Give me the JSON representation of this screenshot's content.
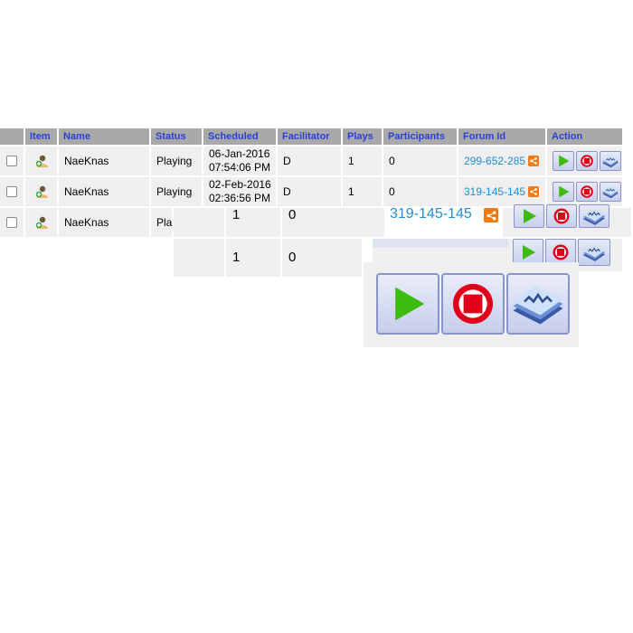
{
  "table": {
    "headers": [
      "",
      "Item",
      "Name",
      "Status",
      "Scheduled",
      "Facilitator",
      "Plays",
      "Participants",
      "Forum Id",
      "Action"
    ],
    "rows": [
      {
        "name": "NaeKnas",
        "status": "Playing",
        "date": "06-Jan-2016",
        "time": "07:54:06 PM",
        "facilitator": "D",
        "plays": "1",
        "participants": "0",
        "forum_id": "299-652-285"
      },
      {
        "name": "NaeKnas",
        "status": "Playing",
        "date": "02-Feb-2016",
        "time": "02:36:56 PM",
        "facilitator": "D",
        "plays": "1",
        "participants": "0",
        "forum_id": "319-145-145"
      },
      {
        "name": "NaeKnas",
        "status": "Play",
        "date": "",
        "time": "",
        "facilitator": "",
        "plays": "",
        "participants": "",
        "forum_id": ""
      }
    ]
  },
  "zoom": {
    "row_a_plays": "1",
    "row_a_participants": "0",
    "row_a_forum_id": "319-145-145",
    "row_b_plays": "1",
    "row_b_participants": "0"
  },
  "icons": {
    "user": "user-icon",
    "share": "share-icon",
    "play": "play-icon",
    "stop": "stop-icon",
    "stats": "stats-icon"
  },
  "colors": {
    "header_bg": "#a9a9a9",
    "header_text": "#2b3fd6",
    "row_bg": "#efefef",
    "link": "#1f8ed8",
    "share": "#f07a12",
    "play_green": "#3dbb10",
    "stop_red": "#e0001a"
  }
}
